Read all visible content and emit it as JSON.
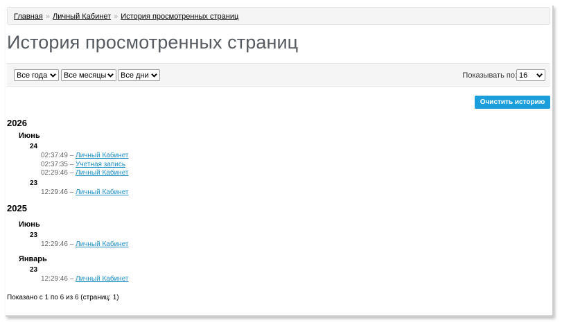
{
  "breadcrumb": {
    "items": [
      "Главная",
      "Личный Кабинет",
      "История просмотренных страниц"
    ],
    "separator": "»"
  },
  "page_title": "История просмотренных страниц",
  "filters": {
    "year": "Все года",
    "month": "Все месяцы",
    "day": "Все дни",
    "per_page_label": "Показывать по:",
    "per_page_value": "16"
  },
  "clear_button_label": "Очистить историю",
  "history": {
    "y2026": {
      "year": "2026",
      "month": "Июнь",
      "day1": "24",
      "e1": {
        "time": "02:37:49 –",
        "link": "Личный Кабинет"
      },
      "e2": {
        "time": "02:37:35 –",
        "link": "Учетная запись"
      },
      "e3": {
        "time": "02:29:46 –",
        "link": "Личный Кабинет"
      },
      "day2": "23",
      "e4": {
        "time": "12:29:46 –",
        "link": "Личный Кабинет"
      }
    },
    "y2025": {
      "year": "2025",
      "month1": "Июнь",
      "day1": "23",
      "e1": {
        "time": "12:29:46 –",
        "link": "Личный Кабинет"
      },
      "month2": "Январь",
      "day2": "23",
      "e2": {
        "time": "12:29:46 –",
        "link": "Личный Кабинет"
      }
    }
  },
  "footer_count": "Показано с 1 по 6 из 6 (страниц: 1)",
  "colors": {
    "accent": "#1b9fdc",
    "link": "#1b8fc6",
    "title": "#555b61"
  }
}
